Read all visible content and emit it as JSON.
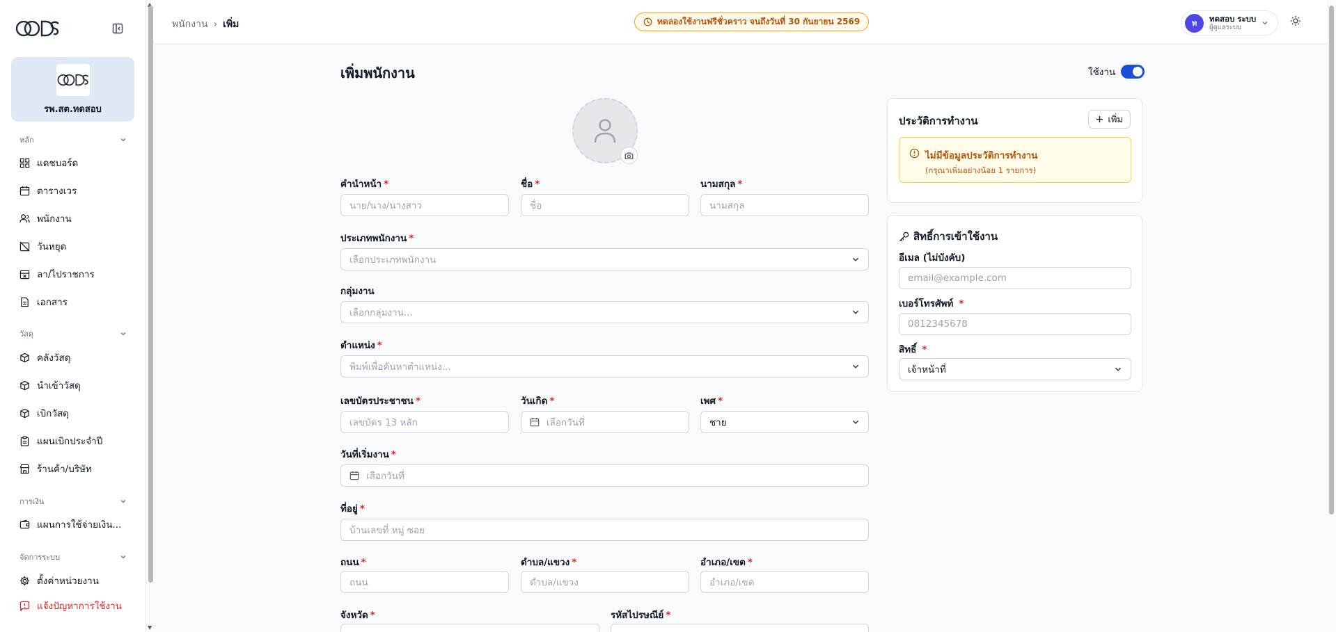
{
  "sidebar": {
    "org_name": "รพ.สต.ทดสอบ",
    "sections": [
      {
        "title": "หลัก"
      },
      {
        "title": "วัสดุ"
      },
      {
        "title": "การเงิน"
      },
      {
        "title": "จัดการระบบ"
      }
    ],
    "items": [
      {
        "label": "แดชบอร์ด",
        "icon": "dashboard-icon"
      },
      {
        "label": "ตารางเวร",
        "icon": "calendar-icon"
      },
      {
        "label": "พนักงาน",
        "icon": "users-icon"
      },
      {
        "label": "วันหยุด",
        "icon": "calendar-off-icon"
      },
      {
        "label": "ลา/ไปราชการ",
        "icon": "calendar-x-icon"
      },
      {
        "label": "เอกสาร",
        "icon": "document-icon"
      },
      {
        "label": "คลังวัสดุ",
        "icon": "package-icon"
      },
      {
        "label": "นำเข้าวัสดุ",
        "icon": "package-in-icon"
      },
      {
        "label": "เบิกวัสดุ",
        "icon": "package-out-icon"
      },
      {
        "label": "แผนเบิกประจำปี",
        "icon": "clipboard-icon"
      },
      {
        "label": "ร้านค้า/บริษัท",
        "icon": "store-icon"
      },
      {
        "label": "แผนการใช้จ่ายเงิน...",
        "icon": "wallet-icon"
      },
      {
        "label": "ตั้งค่าหน่วยงาน",
        "icon": "gear-icon"
      },
      {
        "label": "แจ้งปัญหาการใช้งาน",
        "icon": "alert-icon",
        "color": "#dc2626"
      }
    ]
  },
  "header": {
    "breadcrumb": [
      "พนักงาน",
      "เพิ่ม"
    ],
    "trial_text": "ทดลองใช้งานฟรีชั่วคราว จนถึงวันที่ 30 กันยายน 2569",
    "user_initial": "ท",
    "user_name": "ทดสอบ ระบบ",
    "user_role": "ผู้ดูแลระบบ"
  },
  "form": {
    "title": "เพิ่มพนักงาน",
    "status_label": "ใช้งาน",
    "status_on": true,
    "fields": {
      "prefix": {
        "label": "คำนำหน้า",
        "placeholder": "นาย/นาง/นางสาว"
      },
      "first_name": {
        "label": "ชื่อ",
        "placeholder": "ชื่อ"
      },
      "last_name": {
        "label": "นามสกุล",
        "placeholder": "นามสกุล"
      },
      "employee_type": {
        "label": "ประเภทพนักงาน",
        "placeholder": "เลือกประเภทพนักงาน"
      },
      "work_group": {
        "label": "กลุ่มงาน",
        "placeholder": "เลือกกลุ่มงาน..."
      },
      "position": {
        "label": "ตำแหน่ง",
        "placeholder": "พิมพ์เพื่อค้นหาตำแหน่ง..."
      },
      "citizen_id": {
        "label": "เลขบัตรประชาชน",
        "placeholder": "เลขบัตร 13 หลัก"
      },
      "birth_date": {
        "label": "วันเกิด",
        "placeholder": "เลือกวันที่"
      },
      "gender": {
        "label": "เพศ",
        "value": "ชาย"
      },
      "start_date": {
        "label": "วันที่เริ่มงาน",
        "placeholder": "เลือกวันที่"
      },
      "address": {
        "label": "ที่อยู่",
        "placeholder": "บ้านเลขที่ หมู่ ซอย"
      },
      "road": {
        "label": "ถนน",
        "placeholder": "ถนน"
      },
      "subdistrict": {
        "label": "ตำบล/แขวง",
        "placeholder": "ตำบล/แขวง"
      },
      "district": {
        "label": "อำเภอ/เขต",
        "placeholder": "อำเภอ/เขต"
      },
      "province": {
        "label": "จังหวัด"
      },
      "postcode": {
        "label": "รหัสไปรษณีย์"
      }
    }
  },
  "work_history": {
    "title": "ประวัติการทำงาน",
    "add_label": "เพิ่ม",
    "empty_title": "ไม่มีข้อมูลประวัติการทำงาน",
    "empty_sub": "(กรุณาเพิ่มอย่างน้อย 1 รายการ)"
  },
  "access": {
    "title": "สิทธิ์การเข้าใช้งาน",
    "email_label": "อีเมล (ไม่บังคับ)",
    "email_placeholder": "email@example.com",
    "phone_label": "เบอร์โทรศัพท์",
    "phone_placeholder": "0812345678",
    "role_label": "สิทธิ์",
    "role_value": "เจ้าหน้าที่"
  },
  "colors": {
    "accent": "#1d4ed8",
    "required": "#dc2626",
    "warning": "#b45309"
  }
}
